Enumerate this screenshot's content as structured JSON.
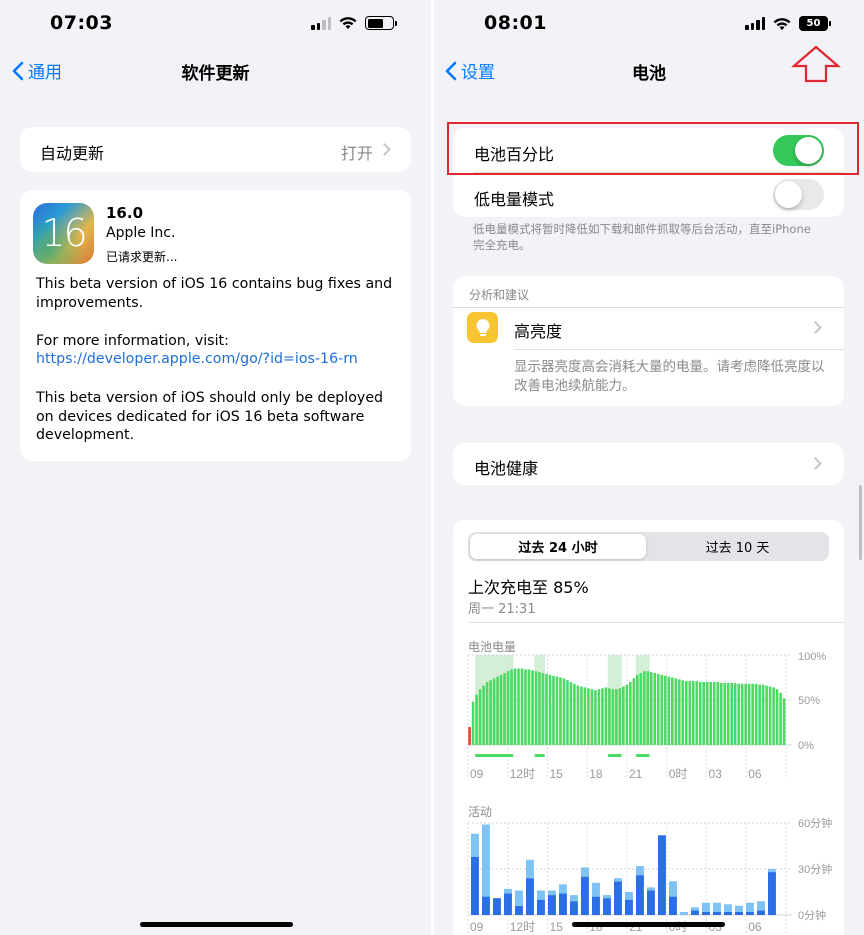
{
  "left": {
    "status": {
      "time": "07:03"
    },
    "nav": {
      "back_label": "通用",
      "title": "软件更新"
    },
    "auto_update": {
      "label": "自动更新",
      "value": "打开"
    },
    "update": {
      "icon_text": "16",
      "version": "16.0",
      "publisher": "Apple Inc.",
      "status": "已请求更新...",
      "desc1": "This beta version of iOS 16 contains bug fixes and improvements.",
      "desc2_prefix": "For more information, visit:",
      "link": "https://developer.apple.com/go/?id=ios-16-rn",
      "desc3": "This beta version of iOS should only be deployed on devices dedicated for iOS 16 beta software development."
    }
  },
  "right": {
    "status": {
      "time": "08:01",
      "battery_percent": "50"
    },
    "nav": {
      "back_label": "设置",
      "title": "电池"
    },
    "battery_percentage": {
      "label": "电池百分比",
      "on": true
    },
    "low_power": {
      "label": "低电量模式",
      "on": false,
      "footer": "低电量模式将暂时降低如下载和邮件抓取等后台活动，直至iPhone完全充电。"
    },
    "insights": {
      "header": "分析和建议",
      "item_label": "高亮度",
      "item_desc": "显示器亮度高会消耗大量的电量。请考虑降低亮度以改善电池续航能力。"
    },
    "battery_health": {
      "label": "电池健康"
    },
    "segments": {
      "tab1": "过去 24 小时",
      "tab2": "过去 10 天",
      "selected": 0
    },
    "last_charge": {
      "title": "上次充电至 85%",
      "time": "周一 21:31"
    },
    "battery_chart": {
      "label": "电池电量",
      "y_ticks": [
        "100%",
        "50%",
        "0%"
      ],
      "x_ticks": [
        "09",
        "12时",
        "15",
        "18",
        "21",
        "0时",
        "03",
        "06"
      ]
    },
    "activity_chart": {
      "label": "活动",
      "y_ticks": [
        "60分钟",
        "30分钟",
        "0分钟"
      ],
      "x_ticks": [
        "09",
        "12时",
        "15",
        "18",
        "21",
        "0时",
        "03",
        "06"
      ]
    },
    "colors": {
      "battery_green": "#4cd964",
      "charging_band": "#d3f0d6",
      "low_red": "#ff3b30",
      "screen_on": "#2a6fe8",
      "screen_off": "#7ec3f4",
      "highlight_box": "#e0262f",
      "arrow": "#e0262f"
    }
  },
  "chart_data": [
    {
      "type": "bar",
      "ylabel": "电池电量",
      "ylim": [
        0,
        100
      ],
      "categories": [
        "09",
        "",
        "",
        "",
        "",
        "",
        "",
        "",
        "",
        "",
        "",
        "",
        "12时",
        "",
        "",
        "",
        "",
        "",
        "",
        "",
        "",
        "",
        "",
        "",
        "15",
        "",
        "",
        "",
        "",
        "",
        "",
        "",
        "",
        "",
        "",
        "",
        "18",
        "",
        "",
        "",
        "",
        "",
        "",
        "",
        "",
        "",
        "",
        "",
        "21",
        "",
        "",
        "",
        "",
        "",
        "",
        "",
        "",
        "",
        "",
        "",
        "0时",
        "",
        "",
        "",
        "",
        "",
        "",
        "",
        "",
        "",
        "",
        "",
        "03",
        "",
        "",
        "",
        "",
        "",
        "",
        "",
        "",
        "",
        "",
        "",
        "06",
        "",
        "",
        "",
        "",
        "",
        "",
        "",
        "",
        "",
        ""
      ],
      "values": [
        20,
        48,
        56,
        62,
        66,
        70,
        72,
        74,
        76,
        78,
        80,
        82,
        84,
        85,
        85,
        85,
        84,
        84,
        83,
        82,
        81,
        80,
        79,
        78,
        77,
        76,
        75,
        74,
        72,
        70,
        68,
        66,
        65,
        64,
        63,
        62,
        61,
        62,
        63,
        64,
        63,
        62,
        62,
        63,
        65,
        67,
        70,
        74,
        78,
        80,
        82,
        82,
        81,
        80,
        79,
        78,
        77,
        76,
        75,
        74,
        73,
        72,
        71,
        71,
        71,
        71,
        70,
        70,
        70,
        70,
        70,
        70,
        69,
        69,
        69,
        69,
        69,
        68,
        68,
        68,
        68,
        68,
        68,
        67,
        67,
        66,
        65,
        64,
        62,
        58,
        52
      ]
    },
    {
      "type": "bar",
      "ylabel": "活动",
      "ylim": [
        0,
        60
      ],
      "categories": [
        "09",
        "12时",
        "15",
        "18",
        "21",
        "0时",
        "03",
        "06"
      ],
      "series": [
        {
          "name": "",
          "values": [
            38,
            12,
            11,
            14,
            6,
            24,
            10,
            13,
            14,
            9,
            25,
            12,
            11,
            22,
            10,
            26,
            16,
            52,
            12,
            0,
            3,
            2,
            2,
            2,
            2,
            2,
            3,
            28
          ]
        },
        {
          "name": "",
          "values": [
            15,
            47,
            0,
            3,
            10,
            12,
            6,
            3,
            6,
            4,
            6,
            9,
            2,
            2,
            5,
            6,
            2,
            0,
            10,
            2,
            2,
            6,
            6,
            5,
            4,
            6,
            6,
            2
          ]
        }
      ]
    }
  ]
}
